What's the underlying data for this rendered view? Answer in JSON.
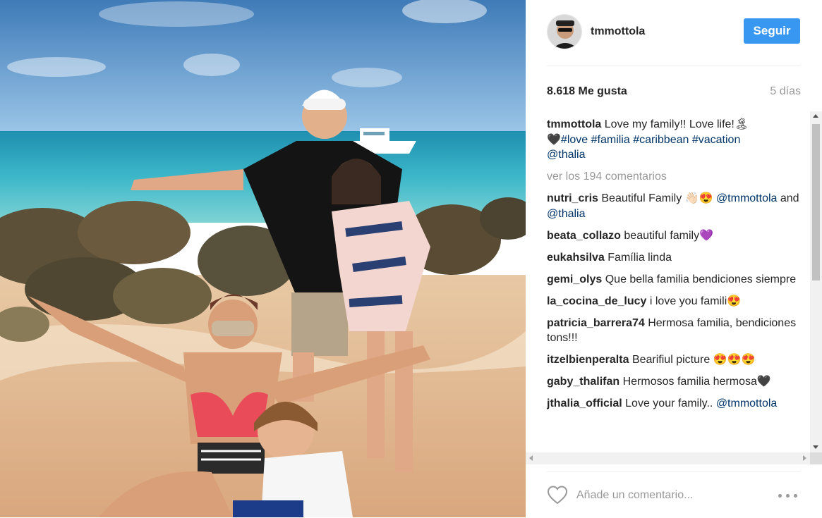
{
  "post": {
    "username": "tmmottola",
    "follow_label": "Seguir",
    "likes": "8.618 Me gusta",
    "time_ago": "5 días",
    "caption": {
      "user": "tmmottola",
      "text": "Love my family!! Love life!🏝",
      "line2_emoji": "🖤",
      "hashtags": [
        "#love",
        "#familia",
        "#caribbean",
        "#vacation"
      ],
      "mention": "@thalia"
    },
    "view_comments": "ver los 194 comentarios",
    "comment_placeholder": "Añade un comentario...",
    "heart_icon": "heart-outline-icon",
    "options_icon": "more-options-icon"
  },
  "comments": [
    {
      "user": "nutri_cris",
      "text": "Beautiful Family 👋🏻😍",
      "mention": "@tmmottola",
      "after": "and",
      "mention2": "@thalia"
    },
    {
      "user": "beata_collazo",
      "text": "beautiful family💜"
    },
    {
      "user": "eukahsilva",
      "text": "Família linda"
    },
    {
      "user": "gemi_olys",
      "text": "Que bella familia bendiciones siempre"
    },
    {
      "user": "la_cocina_de_lucy",
      "text": "i love you famili😍"
    },
    {
      "user": "patricia_barrera74",
      "text": "Hermosa familia, bendiciones tons!!!"
    },
    {
      "user": "itzelbienperalta",
      "text": "Bearifiul picture 😍😍😍"
    },
    {
      "user": "gaby_thalifan",
      "text": "Hermosos familia hermosa🖤"
    },
    {
      "user": "jthalia_official",
      "text": "Love your family..",
      "mention": "@tmmottola"
    }
  ],
  "colors": {
    "accent": "#3897f0",
    "hashtag": "#003569",
    "muted": "#999999",
    "text": "#262626"
  }
}
